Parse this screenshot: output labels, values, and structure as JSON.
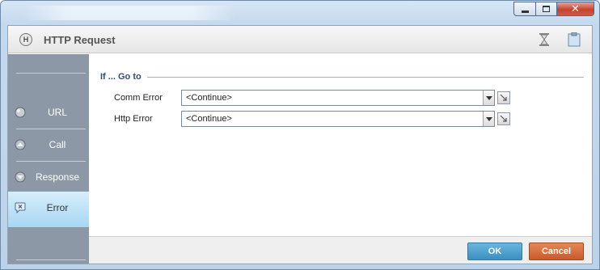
{
  "window": {
    "controls": {
      "minimize_icon": "minimize-icon",
      "maximize_icon": "maximize-icon",
      "close_icon": "close-icon",
      "close_glyph": "✕"
    }
  },
  "header": {
    "title": "HTTP Request",
    "icon_glyph": "H"
  },
  "sidebar": {
    "items": [
      {
        "label": "URL",
        "icon": "globe-icon",
        "active": false
      },
      {
        "label": "Call",
        "icon": "arrow-up-icon",
        "active": false
      },
      {
        "label": "Response",
        "icon": "arrow-down-icon",
        "active": false
      },
      {
        "label": "Error",
        "icon": "error-icon",
        "active": true
      }
    ]
  },
  "main": {
    "section_title": "If ... Go to",
    "fields": [
      {
        "label": "Comm Error",
        "value": "<Continue>"
      },
      {
        "label": "Http Error",
        "value": "<Continue>"
      }
    ]
  },
  "footer": {
    "ok_label": "OK",
    "cancel_label": "Cancel"
  },
  "colors": {
    "accent": "#3c8fc1",
    "cancel": "#c95b2a",
    "sidebar": "#8d98a6",
    "active_item": "#a8d6f3"
  }
}
